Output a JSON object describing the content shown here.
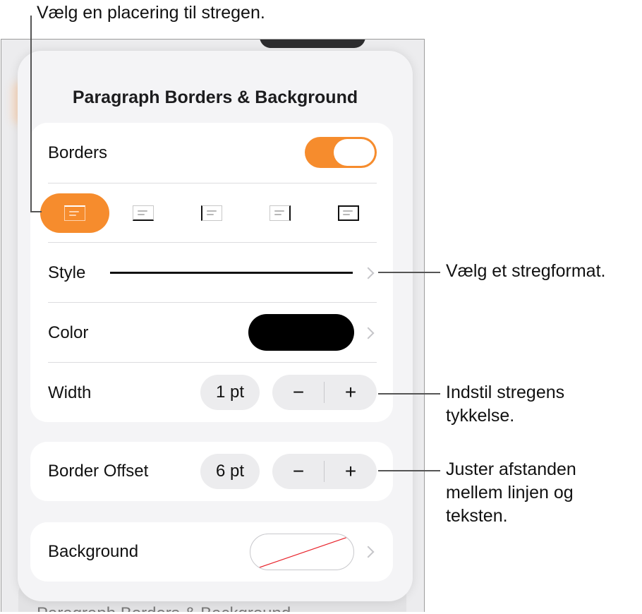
{
  "callouts": {
    "position": "Vælg en placering til stregen.",
    "style": "Vælg et stregformat.",
    "width_line1": "Indstil stregens",
    "width_line2": "tykkelse.",
    "offset_line1": "Juster afstanden",
    "offset_line2": "mellem linjen og",
    "offset_line3": "teksten."
  },
  "panel": {
    "title": "Paragraph Borders & Background",
    "borders": {
      "label": "Borders",
      "toggle_on": true,
      "positions": [
        {
          "name": "top",
          "selected": true
        },
        {
          "name": "bottom",
          "selected": false
        },
        {
          "name": "left",
          "selected": false
        },
        {
          "name": "right",
          "selected": false
        },
        {
          "name": "all",
          "selected": false
        }
      ]
    },
    "style": {
      "label": "Style"
    },
    "color": {
      "label": "Color",
      "value_color": "#000000"
    },
    "width": {
      "label": "Width",
      "value": "1 pt",
      "minus": "−",
      "plus": "+"
    },
    "offset": {
      "label": "Border Offset",
      "value": "6 pt",
      "minus": "−",
      "plus": "+"
    },
    "background": {
      "label": "Background"
    }
  },
  "behind": {
    "bottom_text": "Paragraph Borders & Background"
  },
  "colors": {
    "accent": "#f68c2d",
    "panel_bg": "#f4f4f6",
    "card_bg": "#ffffff"
  }
}
